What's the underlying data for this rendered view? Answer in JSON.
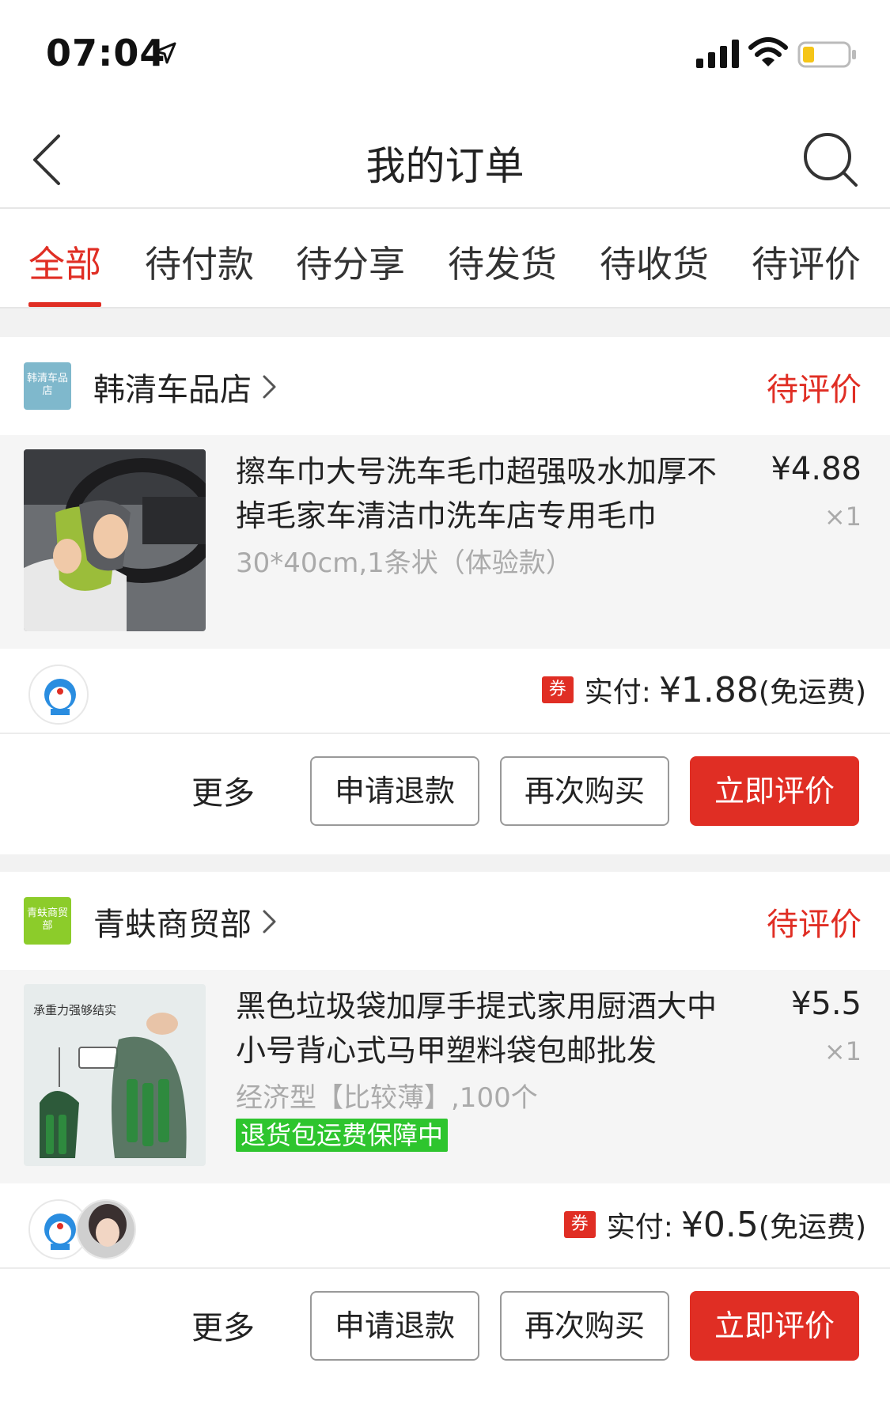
{
  "status_bar": {
    "time": "07:04"
  },
  "header": {
    "title": "我的订单"
  },
  "tabs": [
    {
      "label": "全部",
      "active": true
    },
    {
      "label": "待付款"
    },
    {
      "label": "待分享"
    },
    {
      "label": "待发货"
    },
    {
      "label": "待收货"
    },
    {
      "label": "待评价"
    }
  ],
  "orders": [
    {
      "shop": {
        "name": "韩清车品店",
        "logo_text": "韩清车品店",
        "logo_color": "#7fb8cc"
      },
      "status": "待评价",
      "product": {
        "title": "擦车巾大号洗车毛巾超强吸水加厚不掉毛家车清洁巾洗车店专用毛巾",
        "spec": "30*40cm,1条状（体验款）",
        "price": "¥4.88",
        "quantity": "×1"
      },
      "payment": {
        "coupon": "券",
        "label": "实付:",
        "amount": "¥1.88",
        "shipping": "(免运费)"
      },
      "actions": {
        "more": "更多",
        "refund": "申请退款",
        "rebuy": "再次购买",
        "review": "立即评价"
      }
    },
    {
      "shop": {
        "name": "青蚨商贸部",
        "logo_text": "青蚨商贸部",
        "logo_color": "#8ccc2a"
      },
      "status": "待评价",
      "product": {
        "title": "黑色垃圾袋加厚手提式家用厨酒大中小号背心式马甲塑料袋包邮批发",
        "spec": "经济型【比较薄】,100个",
        "guarantee": "退货包运费保障中",
        "price": "¥5.5",
        "quantity": "×1",
        "image_caption": "承重力强够结实"
      },
      "payment": {
        "coupon": "券",
        "label": "实付:",
        "amount": "¥0.5",
        "shipping": "(免运费)"
      },
      "actions": {
        "more": "更多",
        "refund": "申请退款",
        "rebuy": "再次购买",
        "review": "立即评价"
      }
    }
  ],
  "colors": {
    "accent": "#e02e24",
    "guarantee": "#2ec52e"
  }
}
